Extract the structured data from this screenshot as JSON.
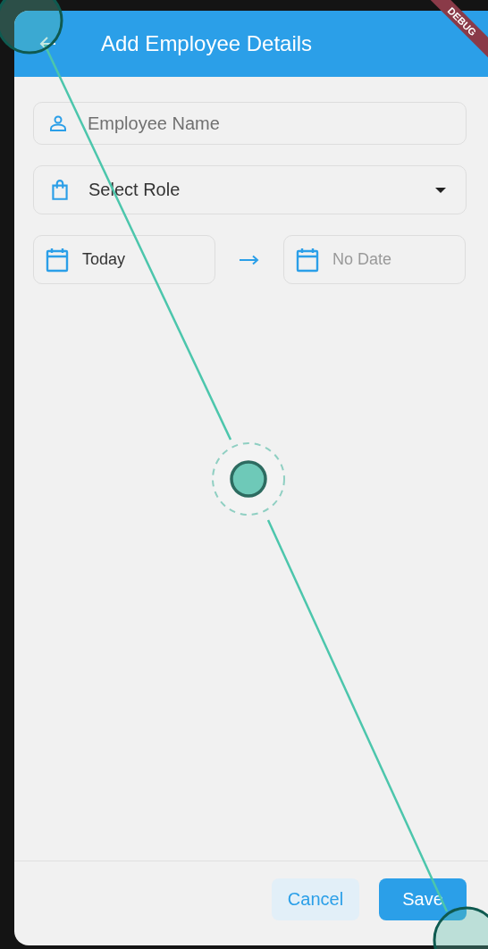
{
  "app_bar": {
    "title": "Add Employee Details"
  },
  "debug_banner": "DEBUG",
  "fields": [
    {
      "kind": "text",
      "placeholder": "Employee Name"
    },
    {
      "kind": "dropdown",
      "value": "Select Role"
    }
  ],
  "date_range": {
    "start": {
      "text": "Today",
      "is_placeholder": false
    },
    "end": {
      "text": "No Date",
      "is_placeholder": true
    }
  },
  "buttons": [
    {
      "label": "Cancel",
      "kind": "secondary"
    },
    {
      "label": "Save",
      "kind": "primary"
    }
  ]
}
